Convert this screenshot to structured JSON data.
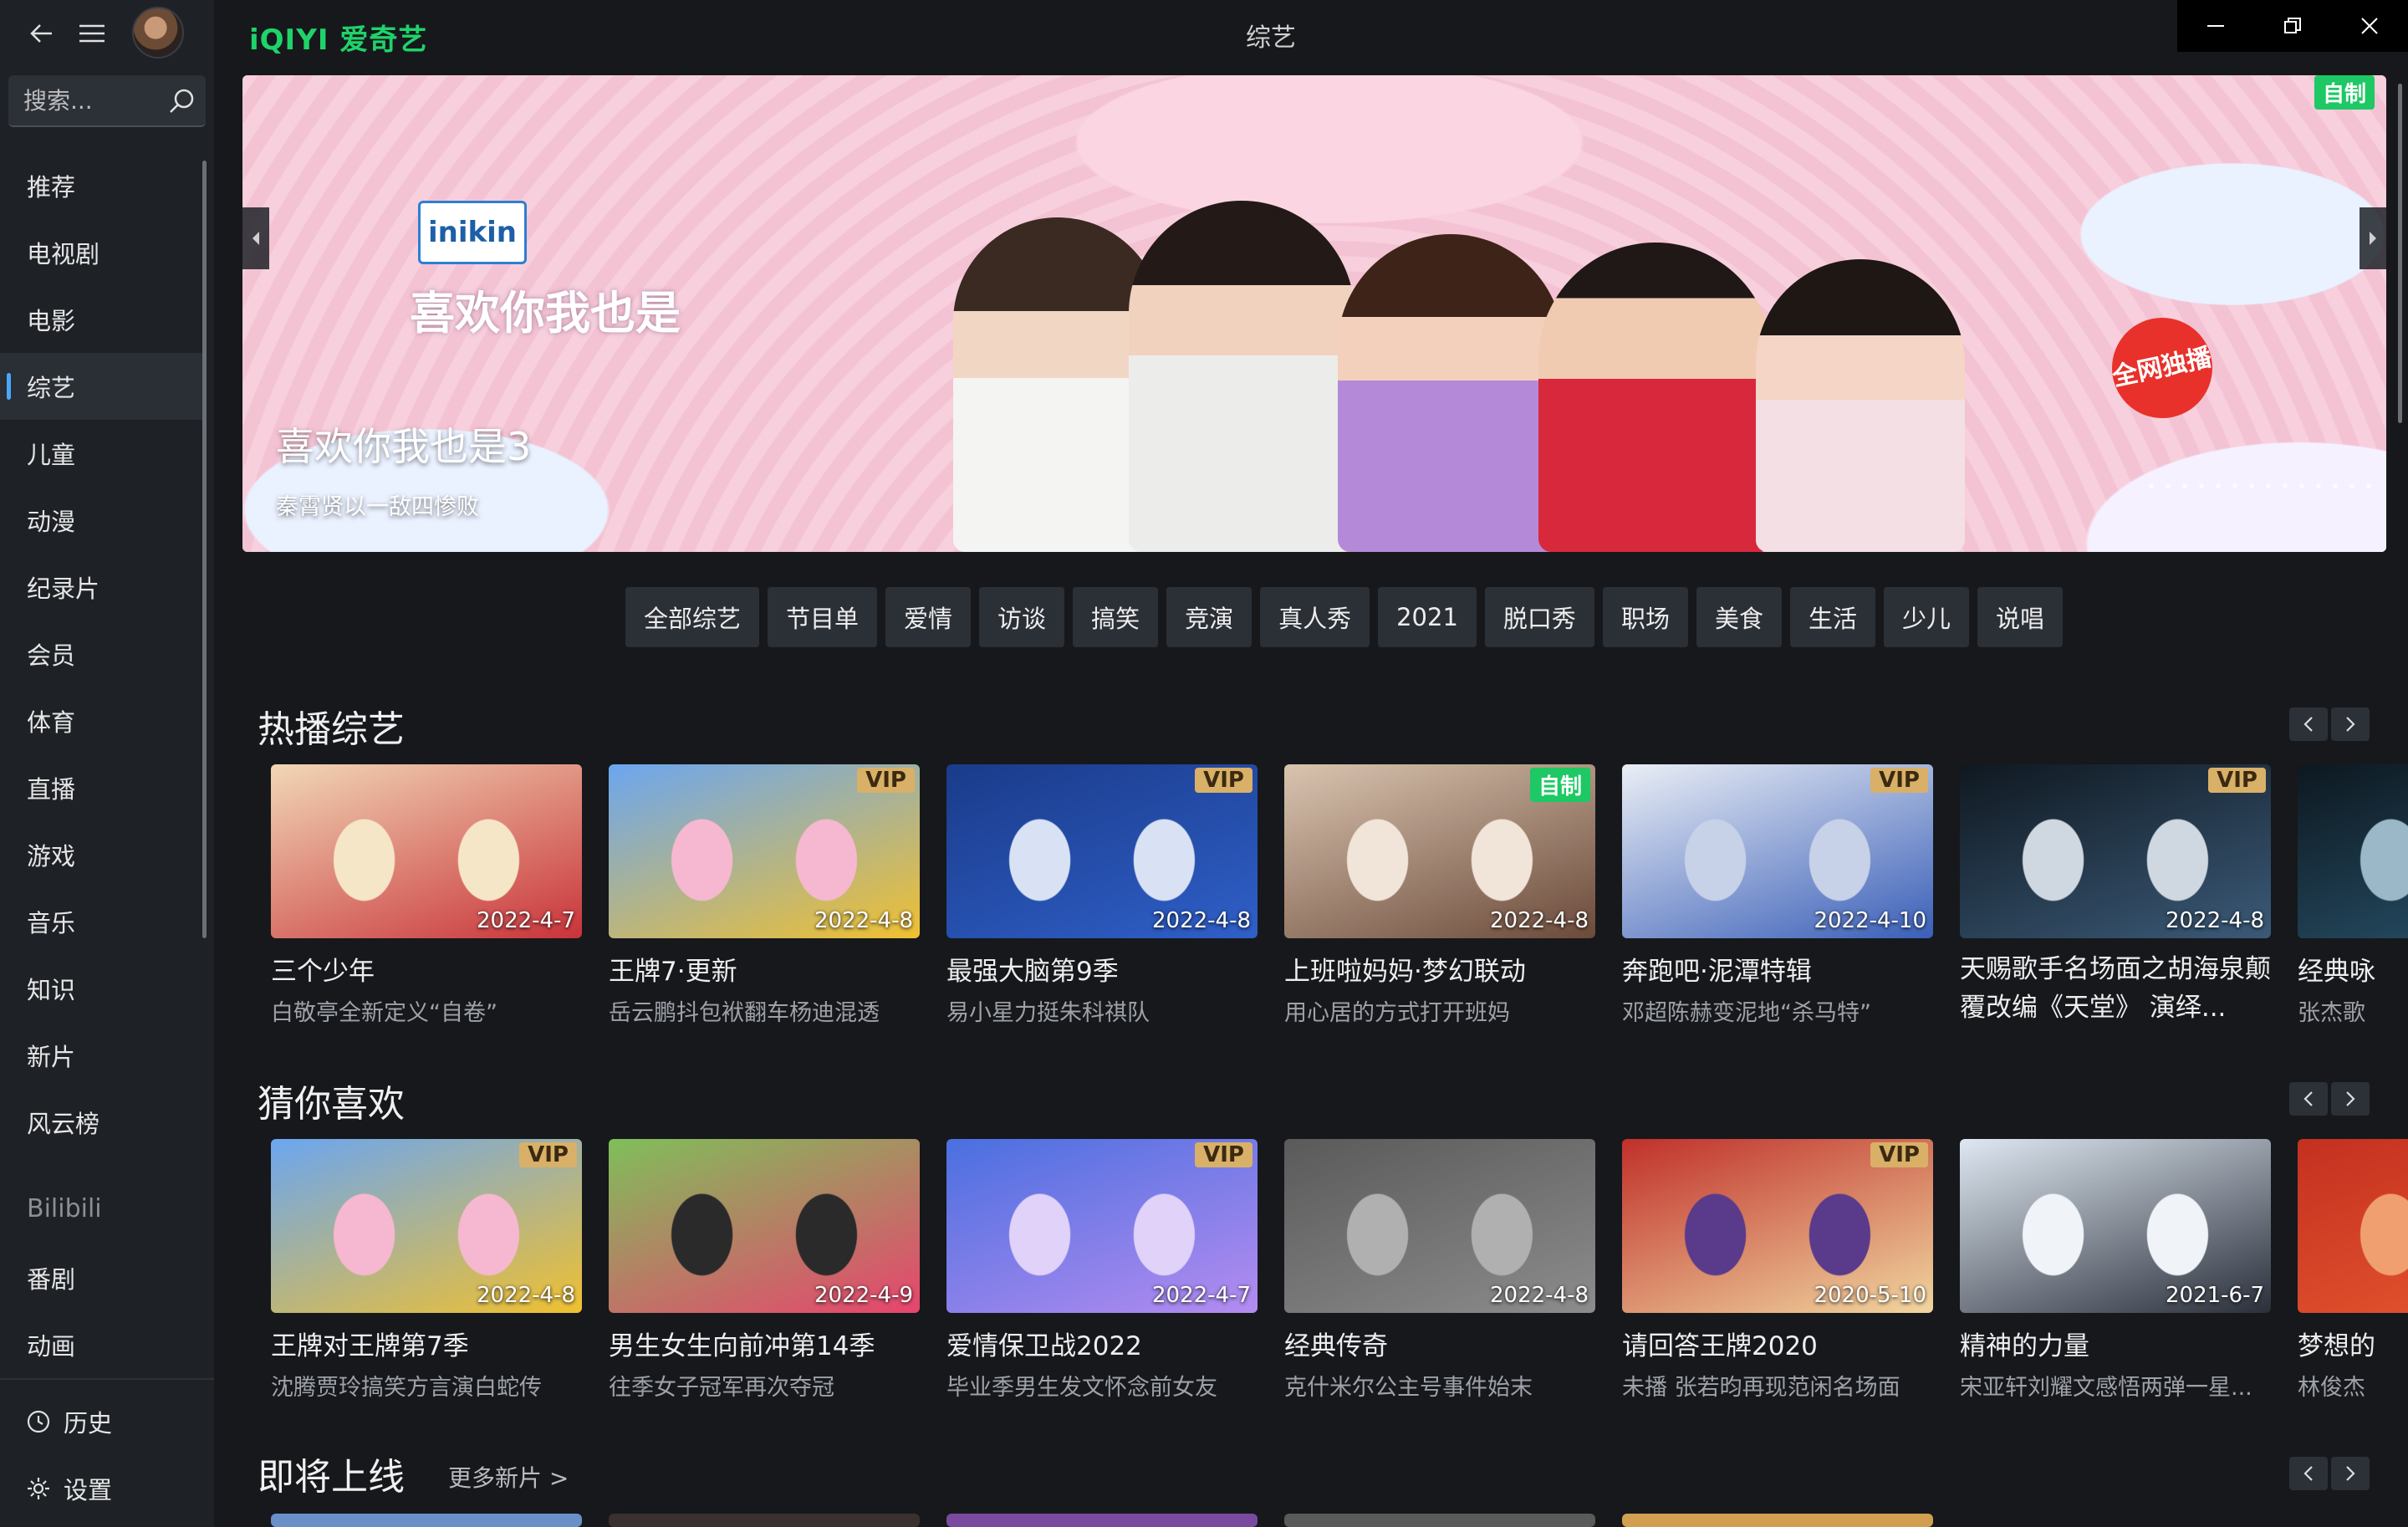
{
  "app": {
    "logo": "iQIYI 爱奇艺",
    "page_title": "综艺"
  },
  "search": {
    "placeholder": "搜索..."
  },
  "nav": [
    {
      "label": "推荐"
    },
    {
      "label": "电视剧"
    },
    {
      "label": "电影"
    },
    {
      "label": "综艺",
      "active": true
    },
    {
      "label": "儿童"
    },
    {
      "label": "动漫"
    },
    {
      "label": "纪录片"
    },
    {
      "label": "会员"
    },
    {
      "label": "体育"
    },
    {
      "label": "直播"
    },
    {
      "label": "游戏"
    },
    {
      "label": "音乐"
    },
    {
      "label": "知识"
    },
    {
      "label": "新片"
    },
    {
      "label": "风云榜"
    }
  ],
  "bilibili": {
    "label": "Bilibili",
    "items": [
      {
        "label": "番剧"
      },
      {
        "label": "动画"
      }
    ]
  },
  "bottom_nav": {
    "history": "历史",
    "settings": "设置"
  },
  "banner": {
    "title": "喜欢你我也是3",
    "subtitle": "秦霄贤以一敌四惨败",
    "badge": "自制",
    "brand_logo": "inikin",
    "show_logo": "喜欢你我也是",
    "exclusive": "全网独播"
  },
  "chips": [
    "全部综艺",
    "节目单",
    "爱情",
    "访谈",
    "搞笑",
    "竞演",
    "真人秀",
    "2021",
    "脱口秀",
    "职场",
    "美食",
    "生活",
    "少儿",
    "说唱"
  ],
  "rows": [
    {
      "title": "热播综艺",
      "cards": [
        {
          "title": "三个少年",
          "sub": "白敬亭全新定义“自卷”",
          "date": "2022-4-7",
          "badge": "",
          "colors": [
            "#f1d7b5",
            "#c9333a",
            "#f6e6c8"
          ]
        },
        {
          "title": "王牌7·更新",
          "sub": "岳云鹏抖包袱翻车杨迪混透",
          "date": "2022-4-8",
          "badge": "VIP",
          "colors": [
            "#6ba6f0",
            "#f0c030",
            "#f6b8d0"
          ]
        },
        {
          "title": "最强大脑第9季",
          "sub": "易小星力挺朱科祺队",
          "date": "2022-4-8",
          "badge": "VIP",
          "colors": [
            "#1a3b8a",
            "#2f5fc8",
            "#d9e2f4"
          ]
        },
        {
          "title": "上班啦妈妈·梦幻联动",
          "sub": "用心居的方式打开班妈",
          "date": "2022-4-8",
          "badge": "自制",
          "colors": [
            "#d9c4b0",
            "#6b4a3a",
            "#f1e5da"
          ]
        },
        {
          "title": "奔跑吧·泥潭特辑",
          "sub": "邓超陈赫变泥地“杀马特”",
          "date": "2022-4-10",
          "badge": "VIP",
          "colors": [
            "#eaeef5",
            "#3a5fb8",
            "#c7d2e8"
          ]
        },
        {
          "title": "天赐歌手名场面之胡海泉颠覆改编《天堂》 演绎...",
          "sub": "",
          "date": "2022-4-8",
          "badge": "VIP",
          "colors": [
            "#0f1820",
            "#3b5a78",
            "#cfd8e0"
          ]
        },
        {
          "title": "经典咏",
          "sub": "张杰歌",
          "date": "",
          "badge": "",
          "colors": [
            "#0d1820",
            "#2a5670",
            "#9ab8c8"
          ]
        }
      ]
    },
    {
      "title": "猜你喜欢",
      "cards": [
        {
          "title": "王牌对王牌第7季",
          "sub": "沈腾贾玲搞笑方言演白蛇传",
          "date": "2022-4-8",
          "badge": "VIP",
          "colors": [
            "#6ba6f0",
            "#f0c030",
            "#f6b8d0"
          ]
        },
        {
          "title": "男生女生向前冲第14季",
          "sub": "往季女子冠军再次夺冠",
          "date": "2022-4-9",
          "badge": "",
          "colors": [
            "#7fbf5a",
            "#e8446e",
            "#2a2a2a"
          ]
        },
        {
          "title": "爱情保卫战2022",
          "sub": "毕业季男生发文怀念前女友",
          "date": "2022-4-7",
          "badge": "VIP",
          "colors": [
            "#4a6fe0",
            "#b48cf0",
            "#e0d2f8"
          ]
        },
        {
          "title": "经典传奇",
          "sub": "克什米尔公主号事件始末",
          "date": "2022-4-8",
          "badge": "",
          "colors": [
            "#5a5a5a",
            "#8c8c8c",
            "#b0b0b0"
          ]
        },
        {
          "title": "请回答王牌2020",
          "sub": "未播 张若昀再现范闲名场面",
          "date": "2020-5-10",
          "badge": "VIP",
          "colors": [
            "#c0302a",
            "#f0d6a0",
            "#5a3a8a"
          ]
        },
        {
          "title": "精神的力量",
          "sub": "宋亚轩刘耀文感悟两弹一星...",
          "date": "2021-6-7",
          "badge": "",
          "colors": [
            "#dfe8f2",
            "#2a2f3a",
            "#f0f3f7"
          ]
        },
        {
          "title": "梦想的",
          "sub": "林俊杰",
          "date": "",
          "badge": "",
          "colors": [
            "#c43020",
            "#e85a30",
            "#f0a070"
          ]
        }
      ]
    },
    {
      "title": "即将上线",
      "more": "更多新片 >"
    }
  ],
  "colors": {
    "accent_green": "#1ec864",
    "active_indicator": "#4aa7ff",
    "vip_gold": "#d9b068"
  }
}
